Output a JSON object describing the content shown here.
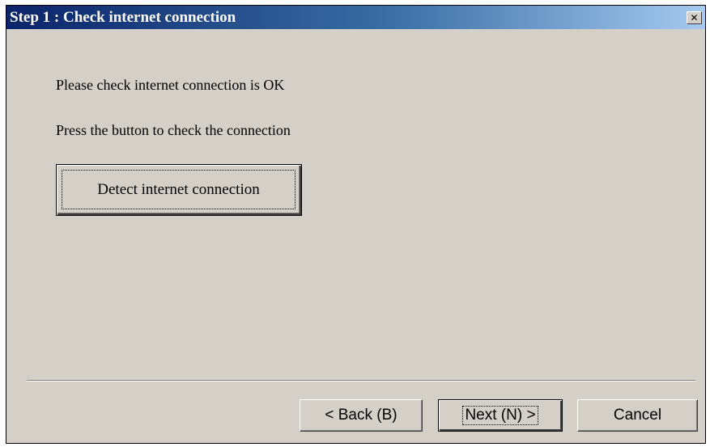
{
  "window": {
    "title": "Step 1 : Check internet connection",
    "close_glyph": "✕",
    "close_icon": "close-icon"
  },
  "content": {
    "line1": "Please check internet connection is OK",
    "line2": "Press the button to check the connection",
    "detect_button_label": "Detect internet connection"
  },
  "footer": {
    "back_label": "< Back (B)",
    "next_label": "Next (N) >",
    "cancel_label": "Cancel"
  },
  "colors": {
    "face": "#d4d0c8",
    "title_start": "#0a246a",
    "title_end": "#a6caf0"
  }
}
